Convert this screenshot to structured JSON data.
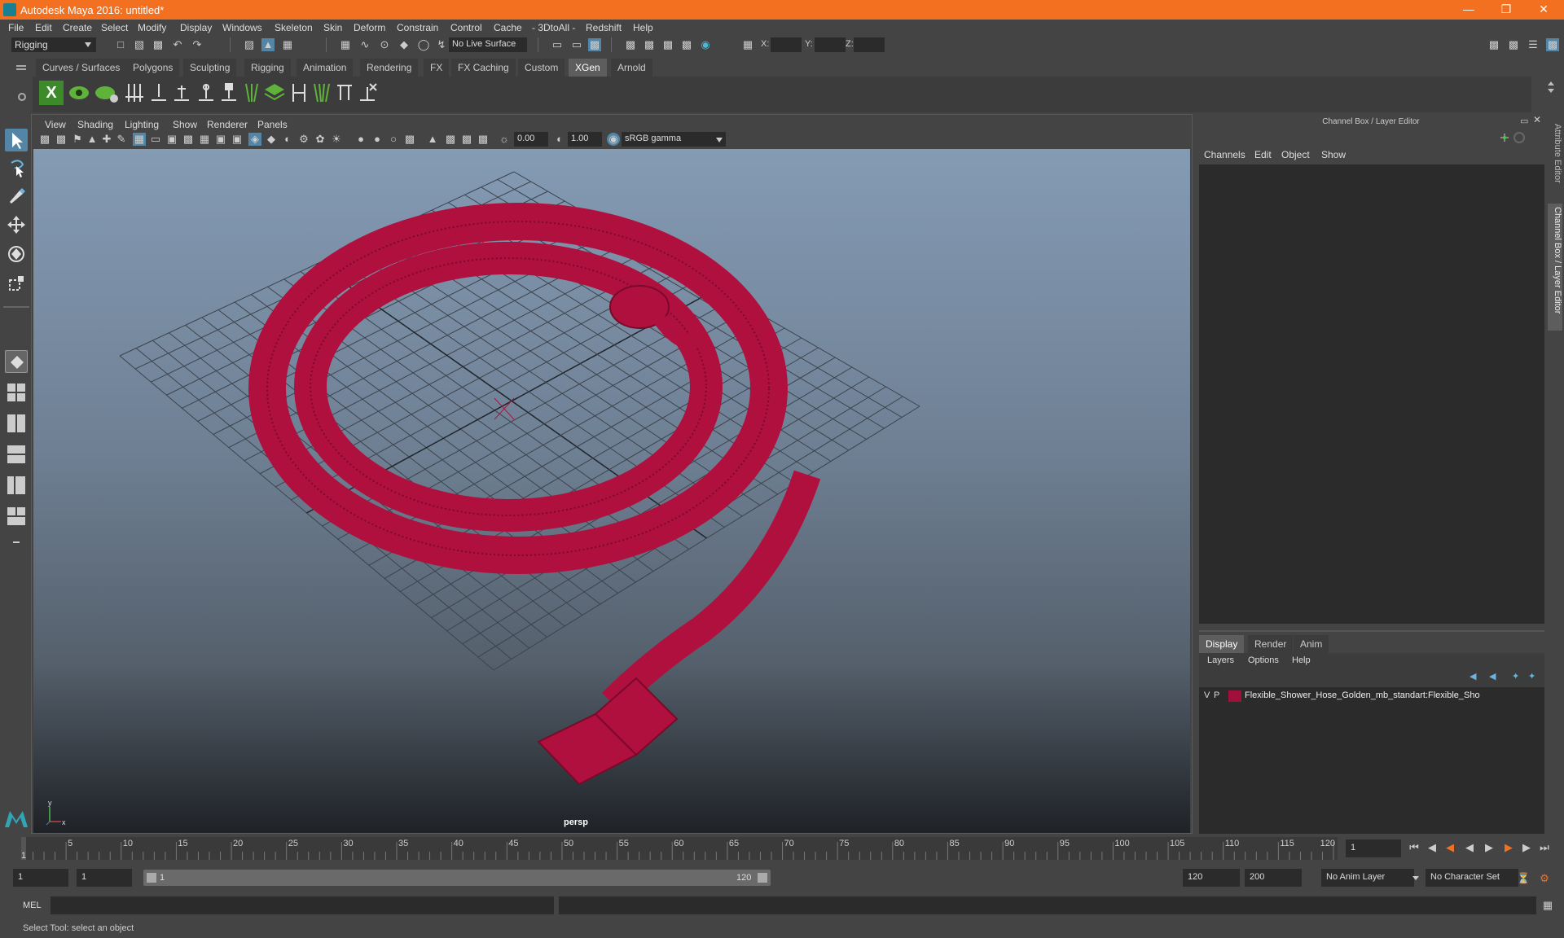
{
  "window": {
    "title": "Autodesk Maya 2016: untitled*"
  },
  "menus": [
    "File",
    "Edit",
    "Create",
    "Select",
    "Modify",
    "Display",
    "Windows",
    "Skeleton",
    "Skin",
    "Deform",
    "Constrain",
    "Control",
    "Cache",
    "- 3DtoAll -",
    "Redshift",
    "Help"
  ],
  "status": {
    "mode": "Rigging",
    "live_surface": "No Live Surface",
    "x_label": "X:",
    "y_label": "Y:",
    "z_label": "Z:"
  },
  "shelf": {
    "tabs": [
      "Curves / Surfaces",
      "Polygons",
      "Sculpting",
      "Rigging",
      "Animation",
      "Rendering",
      "FX",
      "FX Caching",
      "Custom",
      "XGen",
      "Arnold"
    ],
    "active_tab": "XGen"
  },
  "viewport": {
    "menus": [
      "View",
      "Shading",
      "Lighting",
      "Show",
      "Renderer",
      "Panels"
    ],
    "exposure": "0.00",
    "gamma": "1.00",
    "color_space": "sRGB gamma",
    "camera_label": "persp",
    "object_color": "#b0103e"
  },
  "channel_box": {
    "title": "Channel Box / Layer Editor",
    "menus": [
      "Channels",
      "Edit",
      "Object",
      "Show"
    ]
  },
  "layer_editor": {
    "tabs": [
      "Display",
      "Render",
      "Anim"
    ],
    "active_tab": "Display",
    "menus": [
      "Layers",
      "Options",
      "Help"
    ],
    "layers": [
      {
        "v": "V",
        "p": "P",
        "color": "#a0103a",
        "name": "Flexible_Shower_Hose_Golden_mb_standart:Flexible_Sho"
      }
    ]
  },
  "side_tabs": [
    "Attribute Editor",
    "Channel Box / Layer Editor"
  ],
  "timeline": {
    "ticks": [
      "5",
      "10",
      "15",
      "20",
      "25",
      "30",
      "35",
      "40",
      "45",
      "50",
      "55",
      "60",
      "65",
      "70",
      "75",
      "80",
      "85",
      "90",
      "95",
      "100",
      "105",
      "110",
      "115",
      "120"
    ],
    "current_frame_marker": "1",
    "current_frame": "1"
  },
  "range": {
    "start": "1",
    "playback_start": "1",
    "slider_start": "1",
    "slider_end": "120",
    "playback_end": "120",
    "end": "200",
    "anim_layer": "No Anim Layer",
    "character_set": "No Character Set"
  },
  "command_line": {
    "label": "MEL"
  },
  "help_line": {
    "text": "Select Tool: select an object"
  }
}
